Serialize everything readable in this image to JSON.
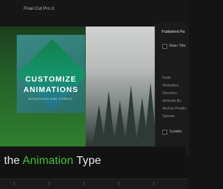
{
  "window": {
    "title": "Final Cut Pro X"
  },
  "viewer": {
    "overlay_title_line1": "CUSTOMIZE",
    "overlay_title_line2": "ANIMATIONS",
    "overlay_subtitle": "MOUNTAINS AND FOREST",
    "colors": {
      "left_pane": "#2f7f2f",
      "overlay": "#13946b"
    }
  },
  "inspector": {
    "header": "Published Pa",
    "main_title_label": "Main Title",
    "params": [
      "Fade",
      "Animation",
      "Direction",
      "Animate By",
      "Anchor Positio",
      "Spread"
    ],
    "subtitle_label": "Subtitle"
  },
  "caption": {
    "before": "e the ",
    "highlight": "Animation",
    "after": " Type",
    "highlight_color": "#4bc23c"
  }
}
